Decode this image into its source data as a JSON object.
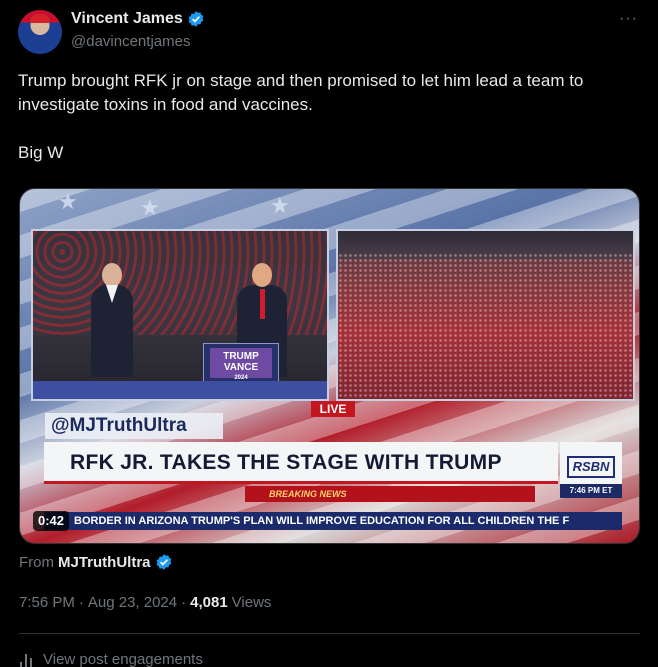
{
  "author": {
    "display_name": "Vincent James",
    "handle": "@davincentjames",
    "verified": true
  },
  "menu_icon": "more-dots-icon",
  "tweet": {
    "paragraphs": [
      "Trump brought RFK jr on stage and then promised to let him lead a team to investigate toxins in food and vaccines.",
      "Big W"
    ]
  },
  "video": {
    "duration": "0:42",
    "live_label": "LIVE",
    "watermark": "@MJTruthUltra",
    "headline": "RFK JR. TAKES THE STAGE WITH TRUMP",
    "breaking_label": "BREAKING NEWS",
    "network_logo": "RSBN",
    "network_time": "7:46 PM ET",
    "ticker": "BORDER IN ARIZONA     TRUMP'S PLAN WILL IMPROVE EDUCATION FOR ALL CHILDREN     THE F",
    "podium_sign": [
      "TRUMP",
      "VANCE",
      "2024"
    ]
  },
  "source": {
    "from_label": "From",
    "account": "MJTruthUltra",
    "verified": true
  },
  "meta": {
    "time": "7:56 PM",
    "date": "Aug 23, 2024",
    "views_count": "4,081",
    "views_label": "Views",
    "separator": "·"
  },
  "engagements_label": "View post engagements",
  "colors": {
    "background": "#000000",
    "text_primary": "#e7e9ea",
    "text_secondary": "#71767b",
    "verified_blue": "#1d9bf0",
    "border": "#2f3336"
  }
}
